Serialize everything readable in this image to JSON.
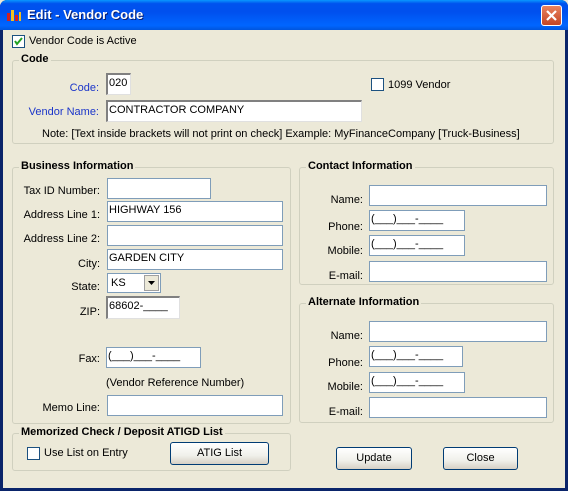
{
  "window": {
    "title": "Edit - Vendor Code"
  },
  "active_checkbox": {
    "label": "Vendor Code is Active",
    "checked": true
  },
  "code_group": {
    "title": "Code",
    "code_label": "Code:",
    "code_value": "020",
    "vendor_1099_label": "1099 Vendor",
    "vendor_1099_checked": false,
    "vendor_name_label": "Vendor Name:",
    "vendor_name_value": "CONTRACTOR COMPANY",
    "note": "Note:  [Text inside brackets will not print on check]    Example: MyFinanceCompany [Truck-Business]"
  },
  "business": {
    "title": "Business Information",
    "tax_id_label": "Tax ID Number:",
    "tax_id_value": "",
    "address1_label": "Address Line 1:",
    "address1_value": "HIGHWAY 156",
    "address2_label": "Address Line 2:",
    "address2_value": "",
    "city_label": "City:",
    "city_value": "GARDEN CITY",
    "state_label": "State:",
    "state_value": "KS",
    "zip_label": "ZIP:",
    "zip_value": "68602-____",
    "fax_label": "Fax:",
    "fax_value": "(___)___-____",
    "ref_note": "(Vendor Reference Number)",
    "memo_label": "Memo Line:",
    "memo_value": ""
  },
  "contact": {
    "title": "Contact Information",
    "name_label": "Name:",
    "name_value": "",
    "phone_label": "Phone:",
    "phone_value": "(___)___-____",
    "mobile_label": "Mobile:",
    "mobile_value": "(___)___-____",
    "email_label": "E-mail:",
    "email_value": ""
  },
  "alternate": {
    "title": "Alternate Information",
    "name_label": "Name:",
    "name_value": "",
    "phone_label": "Phone:",
    "phone_value": "(___)___-____",
    "mobile_label": "Mobile:",
    "mobile_value": "(___)___-____",
    "email_label": "E-mail:",
    "email_value": ""
  },
  "memorized": {
    "title": "Memorized Check / Deposit ATIGD List",
    "use_list_label": "Use List on Entry",
    "use_list_checked": false,
    "atig_button": "ATIG List"
  },
  "buttons": {
    "update": "Update",
    "close": "Close"
  },
  "colors": {
    "title_bar": "#0054e3",
    "label_blue": "#1b35c9",
    "dialog_bg": "#ece9d8"
  }
}
